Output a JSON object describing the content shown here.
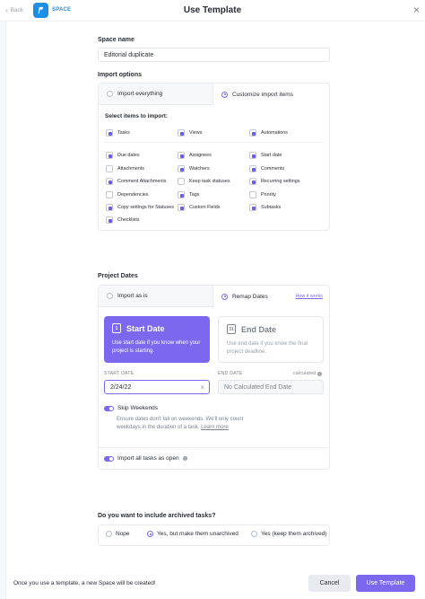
{
  "header": {
    "back_label": "Back",
    "space_label": "SPACE",
    "title": "Use Template",
    "close_glyph": "×"
  },
  "space_name": {
    "label": "Space name",
    "value": "Editorial duplicate"
  },
  "import_options": {
    "label": "Import options",
    "everything_label": "Import everything",
    "customize_label": "Customize import items",
    "selected": "customize",
    "select_items_label": "Select items to import:",
    "items": [
      {
        "label": "Tasks",
        "checked": true
      },
      {
        "label": "Views",
        "checked": true
      },
      {
        "label": "Automations",
        "checked": true
      },
      {
        "label": "Due dates",
        "checked": true
      },
      {
        "label": "Assignees",
        "checked": true
      },
      {
        "label": "Start date",
        "checked": true
      },
      {
        "label": "Attachments",
        "checked": false
      },
      {
        "label": "Watchers",
        "checked": true
      },
      {
        "label": "Comments",
        "checked": true
      },
      {
        "label": "Comment Attachments",
        "checked": true
      },
      {
        "label": "Keep task statuses",
        "checked": false
      },
      {
        "label": "Recurring settings",
        "checked": true
      },
      {
        "label": "Dependencies",
        "checked": false
      },
      {
        "label": "Tags",
        "checked": true
      },
      {
        "label": "Priority",
        "checked": false
      },
      {
        "label": "Copy settings for Statuses",
        "checked": true
      },
      {
        "label": "Custom Fields",
        "checked": true
      },
      {
        "label": "Subtasks",
        "checked": true
      },
      {
        "label": "Checklists",
        "checked": true
      }
    ]
  },
  "project_dates": {
    "label": "Project Dates",
    "import_as_is_label": "Import as is",
    "remap_label": "Remap Dates",
    "how_it_works": "How it works",
    "selected": "remap",
    "start_tile": {
      "title": "Start Date",
      "text": "Use start date if you know when your project is starting.",
      "icon_text": "1"
    },
    "end_tile": {
      "title": "End Date",
      "text": "Use end date if you know the final project deadline.",
      "icon_text": "31"
    },
    "start_date_caption": "START DATE",
    "start_date_value": "2/24/22",
    "end_date_caption": "END DATE",
    "calculated_label": "calculated",
    "end_date_placeholder": "No Calculated End Date",
    "skip_weekends_label": "Skip Weekends",
    "skip_weekends_on": true,
    "skip_weekends_help": "Ensure dates don't fall on weekends. We'll only count weekdays in the duration of a task.",
    "learn_more": "Learn more",
    "import_open_label": "Import all tasks as open",
    "import_open_on": true
  },
  "archived": {
    "label": "Do you want to include archived tasks?",
    "options": [
      "Nope",
      "Yes, but make them unarchived",
      "Yes (keep them archived)"
    ],
    "selected_index": 1
  },
  "footer": {
    "note": "Once you use a template, a new Space will be created!",
    "cancel_label": "Cancel",
    "submit_label": "Use Template"
  },
  "colors": {
    "accent": "#7b68ee",
    "space_blue": "#1f8fe6"
  }
}
